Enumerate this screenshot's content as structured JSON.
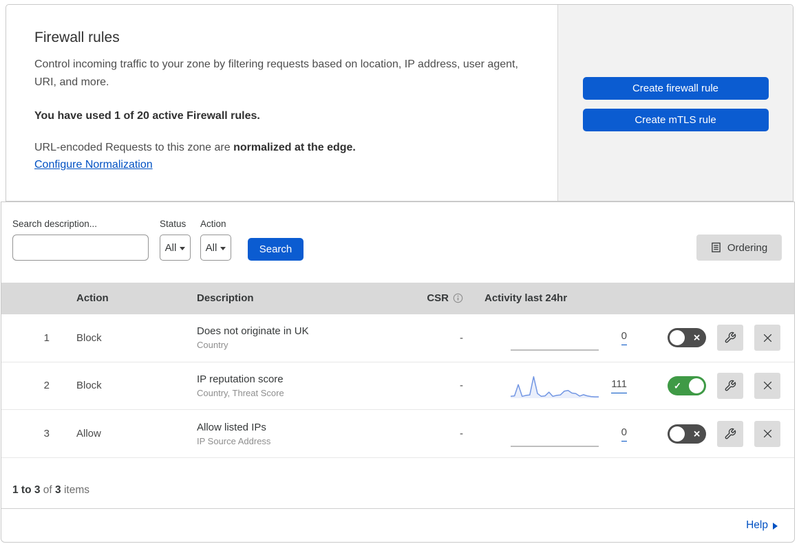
{
  "colors": {
    "primary_button": "#0b5cd1",
    "link_blue": "#0051c3",
    "toggle_on": "#3f9a46",
    "toggle_off": "#4d4d4d",
    "table_header_bg": "#d9d9d9",
    "sparkline_blue": "#7296e3",
    "sparkline_flat_gray": "#a8a8a8"
  },
  "icons": {
    "toggle_on_mark": "✓",
    "toggle_off_mark": "✕"
  },
  "panel": {
    "title": "Firewall rules",
    "description": "Control incoming traffic to your zone by filtering requests based on location, IP address, user agent, URI, and more.",
    "usage": "You have used 1 of 20 active Firewall rules.",
    "norm_text": "URL-encoded Requests to this zone are ",
    "norm_bold": "normalized at the edge.",
    "norm_link": "Configure Normalization",
    "create_firewall_label": "Create firewall rule",
    "create_mtls_label": "Create mTLS rule"
  },
  "filters": {
    "search_label": "Search description...",
    "search_value": "",
    "status_label": "Status",
    "status_value": "All",
    "action_label": "Action",
    "action_value": "All",
    "search_button": "Search",
    "ordering_button": "Ordering"
  },
  "table": {
    "headers": {
      "action": "Action",
      "description": "Description",
      "csr": "CSR",
      "activity": "Activity last 24hr"
    },
    "rows": [
      {
        "num": "1",
        "action": "Block",
        "description": "Does not originate in UK",
        "fields": "Country",
        "csr": "-",
        "activity_count": "0",
        "enabled": false,
        "sparkline": {
          "values": [
            0,
            0,
            0,
            0,
            0,
            0,
            0,
            0,
            0,
            0,
            0,
            0,
            0,
            0,
            0,
            0,
            0,
            0,
            0,
            0,
            0,
            0,
            0,
            0
          ],
          "color": "#a8a8a8",
          "fill": false
        }
      },
      {
        "num": "2",
        "action": "Block",
        "description": "IP reputation score",
        "fields": "Country, Threat Score",
        "csr": "-",
        "activity_count": "111",
        "enabled": true,
        "sparkline": {
          "values": [
            8,
            10,
            58,
            8,
            12,
            14,
            92,
            20,
            8,
            10,
            26,
            8,
            12,
            14,
            30,
            33,
            22,
            20,
            9,
            15,
            10,
            7,
            6,
            6
          ],
          "color": "#7296e3",
          "fill": true
        }
      },
      {
        "num": "3",
        "action": "Allow",
        "description": "Allow listed IPs",
        "fields": "IP Source Address",
        "csr": "-",
        "activity_count": "0",
        "enabled": false,
        "sparkline": {
          "values": [
            0,
            0,
            0,
            0,
            0,
            0,
            0,
            0,
            0,
            0,
            0,
            0,
            0,
            0,
            0,
            0,
            0,
            0,
            0,
            0,
            0,
            0,
            0,
            0
          ],
          "color": "#a8a8a8",
          "fill": false
        }
      }
    ]
  },
  "footer": {
    "range": "1 to 3",
    "of_label": "of",
    "total": "3",
    "items_label": "items",
    "help_label": "Help"
  }
}
